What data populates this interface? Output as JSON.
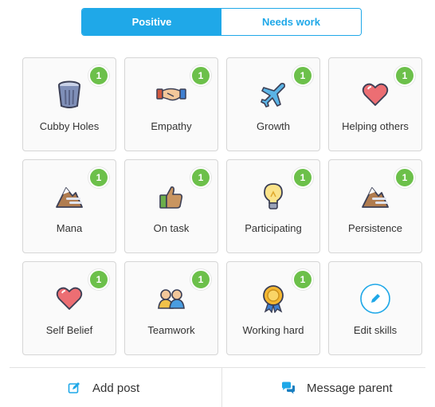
{
  "tabs": {
    "positive": "Positive",
    "needs_work": "Needs work"
  },
  "skills": [
    {
      "label": "Cubby Holes",
      "count": "1",
      "icon": "trash-can-icon"
    },
    {
      "label": "Empathy",
      "count": "1",
      "icon": "handshake-icon"
    },
    {
      "label": "Growth",
      "count": "1",
      "icon": "airplane-icon"
    },
    {
      "label": "Helping others",
      "count": "1",
      "icon": "heart-icon"
    },
    {
      "label": "Mana",
      "count": "1",
      "icon": "mountain-icon"
    },
    {
      "label": "On task",
      "count": "1",
      "icon": "thumbs-up-icon"
    },
    {
      "label": "Participating",
      "count": "1",
      "icon": "lightbulb-icon"
    },
    {
      "label": "Persistence",
      "count": "1",
      "icon": "mountain-icon"
    },
    {
      "label": "Self Belief",
      "count": "1",
      "icon": "heart-icon"
    },
    {
      "label": "Teamwork",
      "count": "1",
      "icon": "people-icon"
    },
    {
      "label": "Working hard",
      "count": "1",
      "icon": "medal-icon"
    },
    {
      "label": "Edit skills",
      "icon": "pencil-icon"
    }
  ],
  "actions": {
    "add_post": "Add post",
    "message_parent": "Message parent"
  },
  "colors": {
    "accent": "#1fa8e8",
    "badge": "#6cc04a"
  }
}
